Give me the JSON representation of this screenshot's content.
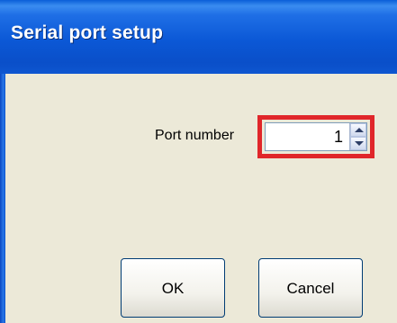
{
  "window": {
    "title": "Serial port setup"
  },
  "form": {
    "port_label": "Port number",
    "port_value": "1"
  },
  "buttons": {
    "ok_label": "OK",
    "cancel_label": "Cancel"
  },
  "colors": {
    "titlebar": "#0b58d6",
    "highlight": "#e0262a",
    "background": "#ece9d8"
  }
}
